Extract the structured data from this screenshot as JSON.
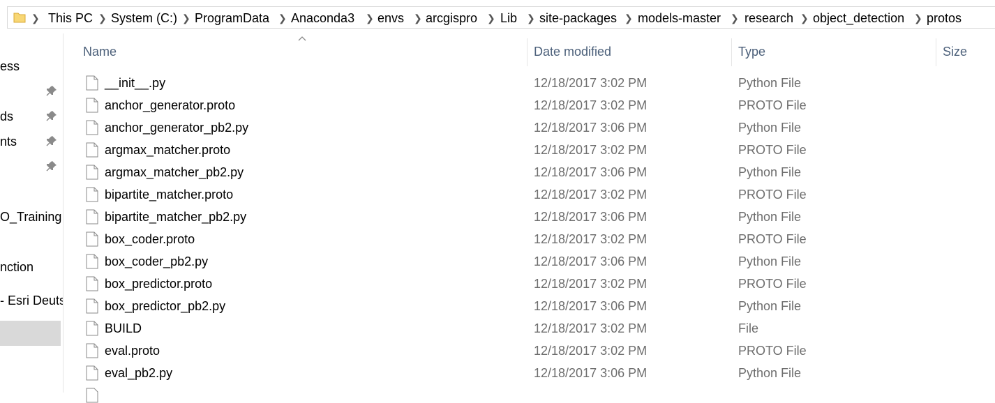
{
  "breadcrumb": [
    "This PC",
    "System (C:)",
    "ProgramData",
    "Anaconda3",
    "envs",
    "arcgispro",
    "Lib",
    "site-packages",
    "models-master",
    "research",
    "object_detection",
    "protos"
  ],
  "nav": {
    "items": [
      "ess",
      "ds",
      "nts",
      "O_Training",
      "nction",
      "- Esri Deuts"
    ]
  },
  "columns": {
    "name": "Name",
    "date": "Date modified",
    "type": "Type",
    "size": "Size"
  },
  "files": [
    {
      "name": "__init__.py",
      "date": "12/18/2017 3:02 PM",
      "type": "Python File"
    },
    {
      "name": "anchor_generator.proto",
      "date": "12/18/2017 3:02 PM",
      "type": "PROTO File"
    },
    {
      "name": "anchor_generator_pb2.py",
      "date": "12/18/2017 3:06 PM",
      "type": "Python File"
    },
    {
      "name": "argmax_matcher.proto",
      "date": "12/18/2017 3:02 PM",
      "type": "PROTO File"
    },
    {
      "name": "argmax_matcher_pb2.py",
      "date": "12/18/2017 3:06 PM",
      "type": "Python File"
    },
    {
      "name": "bipartite_matcher.proto",
      "date": "12/18/2017 3:02 PM",
      "type": "PROTO File"
    },
    {
      "name": "bipartite_matcher_pb2.py",
      "date": "12/18/2017 3:06 PM",
      "type": "Python File"
    },
    {
      "name": "box_coder.proto",
      "date": "12/18/2017 3:02 PM",
      "type": "PROTO File"
    },
    {
      "name": "box_coder_pb2.py",
      "date": "12/18/2017 3:06 PM",
      "type": "Python File"
    },
    {
      "name": "box_predictor.proto",
      "date": "12/18/2017 3:02 PM",
      "type": "PROTO File"
    },
    {
      "name": "box_predictor_pb2.py",
      "date": "12/18/2017 3:06 PM",
      "type": "Python File"
    },
    {
      "name": "BUILD",
      "date": "12/18/2017 3:02 PM",
      "type": "File"
    },
    {
      "name": "eval.proto",
      "date": "12/18/2017 3:02 PM",
      "type": "PROTO File"
    },
    {
      "name": "eval_pb2.py",
      "date": "12/18/2017 3:06 PM",
      "type": "Python File"
    }
  ],
  "colors": {
    "header_text": "#4c607a",
    "secondary_text": "#6d6d6d",
    "selected_bg": "#d9d9d9",
    "folder": "#f8d775"
  },
  "icons": {
    "folder": "folder-icon",
    "pin": "pin-icon",
    "file": "file-icon",
    "separator": "chevron-right-icon",
    "sort": "sort-ascending-icon"
  }
}
